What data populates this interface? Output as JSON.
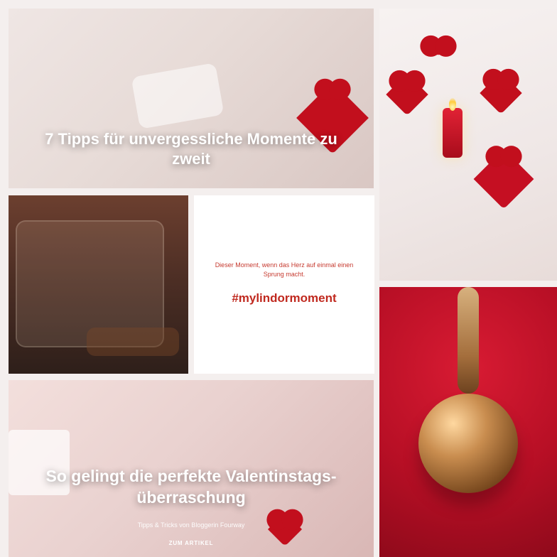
{
  "tiles": {
    "a": {
      "title": "7 Tipps für unvergessliche Momente zu zweit"
    },
    "d": {
      "quote": "Dieser Moment, wenn das Herz auf einmal einen Sprung macht.",
      "hashtag": "#mylindormoment"
    },
    "f": {
      "title": "So gelingt die perfekte Valentinstags-überraschung",
      "subline": "Tipps & Tricks von Bloggerin Fourway",
      "cta": "ZUM ARTIKEL"
    }
  },
  "colors": {
    "page_background": "#f4efee",
    "accent_red": "#c0291f",
    "tile_red": "#b70f25"
  },
  "icons": {
    "avatar_b": "avatar-icon",
    "avatar_c": "avatar-icon"
  }
}
